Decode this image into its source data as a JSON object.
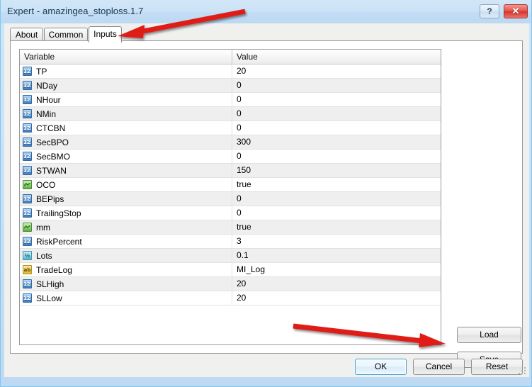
{
  "window": {
    "title": "Expert - amazingea_stoploss.1.7",
    "help_button": "?",
    "close_button": "✕"
  },
  "tabs": [
    {
      "label": "About",
      "selected": false
    },
    {
      "label": "Common",
      "selected": false
    },
    {
      "label": "Inputs",
      "selected": true
    }
  ],
  "grid": {
    "columns": [
      "Variable",
      "Value"
    ],
    "rows": [
      {
        "variable": "TP",
        "value": "20",
        "type": "int",
        "icon": "int-type-icon"
      },
      {
        "variable": "NDay",
        "value": "0",
        "type": "int",
        "icon": "int-type-icon"
      },
      {
        "variable": "NHour",
        "value": "0",
        "type": "int",
        "icon": "int-type-icon"
      },
      {
        "variable": "NMin",
        "value": "0",
        "type": "int",
        "icon": "int-type-icon"
      },
      {
        "variable": "CTCBN",
        "value": "0",
        "type": "int",
        "icon": "int-type-icon"
      },
      {
        "variable": "SecBPO",
        "value": "300",
        "type": "int",
        "icon": "int-type-icon"
      },
      {
        "variable": "SecBMO",
        "value": "0",
        "type": "int",
        "icon": "int-type-icon"
      },
      {
        "variable": "STWAN",
        "value": "150",
        "type": "int",
        "icon": "int-type-icon"
      },
      {
        "variable": "OCO",
        "value": "true",
        "type": "bool",
        "icon": "bool-type-icon"
      },
      {
        "variable": "BEPips",
        "value": "0",
        "type": "int",
        "icon": "int-type-icon"
      },
      {
        "variable": "TrailingStop",
        "value": "0",
        "type": "int",
        "icon": "int-type-icon"
      },
      {
        "variable": "mm",
        "value": "true",
        "type": "bool",
        "icon": "bool-type-icon"
      },
      {
        "variable": "RiskPercent",
        "value": "3",
        "type": "int",
        "icon": "int-type-icon"
      },
      {
        "variable": "Lots",
        "value": "0.1",
        "type": "dbl",
        "icon": "double-type-icon"
      },
      {
        "variable": "TradeLog",
        "value": "MI_Log",
        "type": "str",
        "icon": "string-type-icon"
      },
      {
        "variable": "SLHigh",
        "value": "20",
        "type": "int",
        "icon": "int-type-icon"
      },
      {
        "variable": "SLLow",
        "value": "20",
        "type": "int",
        "icon": "int-type-icon"
      }
    ],
    "icon_glyphs": {
      "int": "123",
      "dbl": "½",
      "str": "ab"
    }
  },
  "side_buttons": {
    "load": "Load",
    "save": "Save"
  },
  "dialog_buttons": {
    "ok": "OK",
    "cancel": "Cancel",
    "reset": "Reset"
  },
  "annotations": {
    "arrow_color": "#e01b17",
    "arrow_top_target": "Inputs tab",
    "arrow_bottom_target": "Save button"
  },
  "colors": {
    "titlebar": "#cbe2f6",
    "client": "#f0f0ef",
    "row_alt": "#efefef",
    "grid_border": "#9a9a9a",
    "ok_focus": "#3c9fd4",
    "close_red": "#d3332c"
  }
}
